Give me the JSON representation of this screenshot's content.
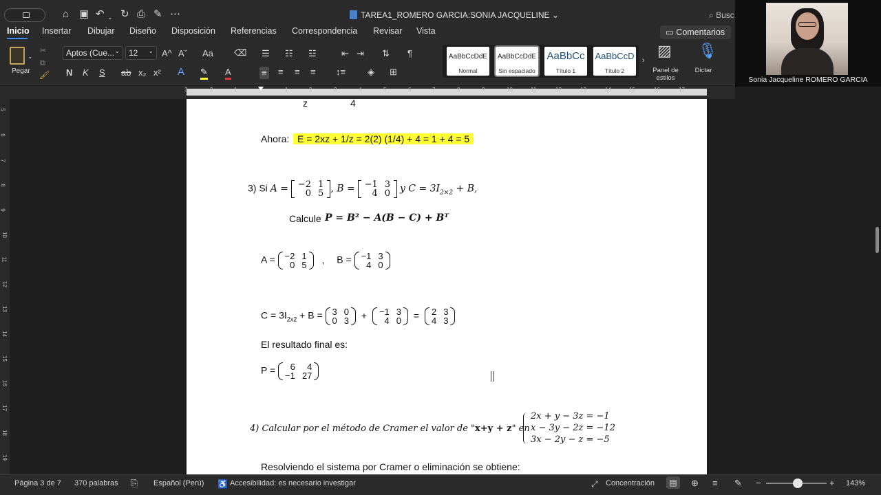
{
  "title_bar": {
    "document_title": "TAREA1_ROMERO GARCIA:SONIA JACQUELINE ⌄",
    "search_label": "Busc"
  },
  "menu": {
    "tabs": [
      "Inicio",
      "Insertar",
      "Dibujar",
      "Diseño",
      "Disposición",
      "Referencias",
      "Correspondencia",
      "Revisar",
      "Vista"
    ],
    "comments_label": "Comentarios"
  },
  "ribbon": {
    "paste_label": "Pegar",
    "font_name": "Aptos (Cue...",
    "font_size": "12",
    "grow_font": "A^",
    "shrink_font": "Aˇ",
    "change_case": "Aa",
    "bold": "N",
    "italic": "K",
    "underline": "S",
    "strikethrough": "ab",
    "subscript": "x₂",
    "superscript": "x²",
    "styles": [
      {
        "sample": "AaBbCcDdE",
        "name": "Normal"
      },
      {
        "sample": "AaBbCcDdE",
        "name": "Sin espaciado"
      },
      {
        "sample": "AaBbCc",
        "name": "Título 1"
      },
      {
        "sample": "AaBbCcD",
        "name": "Título 2"
      }
    ],
    "styles_pane_label": "Panel de estilos",
    "dictate_label": "Dictar",
    "accent_color": "#3d8ef0",
    "highlight_color": "#ffff33"
  },
  "ruler": {
    "numbers": [
      "3",
      "2",
      "1",
      "1",
      "2",
      "3",
      "4",
      "5",
      "6",
      "7",
      "8",
      "9",
      "10",
      "11",
      "12",
      "13",
      "14",
      "15",
      "16",
      "17"
    ],
    "vertical": [
      "5",
      "6",
      "7",
      "8",
      "9",
      "10",
      "11",
      "12",
      "13",
      "14",
      "15",
      "16",
      "17",
      "18",
      "19"
    ]
  },
  "document": {
    "top_z": "z",
    "top_4": "4",
    "ahora_label": "Ahora:",
    "ahora_expr": "E = 2xz + 1/z = 2(2) (1/4) + 4 = 1 + 4 = 5",
    "p3_label": "3) Si",
    "p3_a_eq": "A =",
    "p3_b_eq": "B =",
    "p3_c_eq": "y  C = 3I",
    "p3_c_sub": "2×2",
    "p3_c_tail": " + B,",
    "matA": [
      [
        "−2",
        "1"
      ],
      [
        "0",
        "5"
      ]
    ],
    "matB": [
      [
        "−1",
        "3"
      ],
      [
        "4",
        "0"
      ]
    ],
    "calcule_label": "Calcule",
    "calcule_expr": "P = B² − A(B − C) +  Bᵀ",
    "line_ab_a": "A =",
    "line_ab_b": "B =",
    "line_ab_comma": ",",
    "line_c_label": "C = 3I",
    "line_c_sub": "2x2",
    "line_c_plusb": " + B =",
    "mat3I": [
      [
        "3",
        "0"
      ],
      [
        "0",
        "3"
      ]
    ],
    "matC": [
      [
        "2",
        "3"
      ],
      [
        "4",
        "3"
      ]
    ],
    "plus": "+",
    "equals": "=",
    "result_label": "El resultado final es:",
    "p_label": "P =",
    "matP": [
      [
        "6",
        "4"
      ],
      [
        "−1",
        "27"
      ]
    ],
    "p4_text": "4)  Calcular por el método de Cramer el valor de \"",
    "p4_bold": "x+y + z",
    "p4_end": "\" en",
    "system": [
      "2x + y − 3z = −1",
      "x − 3y − 2z = −12",
      "3x − 2y − z = −5"
    ],
    "resolve_text": "Resolviendo el sistema por Cramer o eliminación se obtiene:"
  },
  "status": {
    "page": "Página 3 de 7",
    "words": "370 palabras",
    "language": "Español (Perú)",
    "accessibility": "Accesibilidad: es necesario investigar",
    "focus": "Concentración",
    "zoom": "143%",
    "zoom_minus": "−",
    "zoom_plus": "+"
  },
  "video": {
    "participant_name": "Sonia Jacqueline ROMERO GARCIA"
  }
}
